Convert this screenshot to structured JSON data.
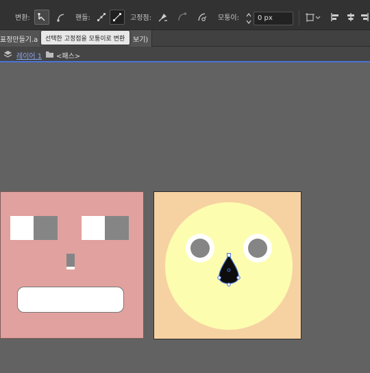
{
  "control_bar": {
    "convert_label": "변환:",
    "handle_label": "핸들:",
    "anchor_label": "고정점:",
    "corner_label": "모퉁이:",
    "corner_value": "0 px"
  },
  "tab": {
    "title_prefix": "표정만들기.a",
    "title_suffix": "보기)"
  },
  "tooltip": "선택한 고정점을 모퉁이로 변환",
  "breadcrumb": {
    "layer": "레이어 1",
    "path": "<패스>"
  },
  "colors": {
    "left_artboard": "#e1a19e",
    "right_artboard": "#f6d2a2",
    "face": "#fdfdb0",
    "eye": "#858585",
    "selection": "#4b74d8"
  },
  "icons": [
    "convert-smooth-icon",
    "convert-corner-icon",
    "handle-show-icon",
    "handle-hide-icon",
    "pen-remove-anchor-icon",
    "anchor-connect-icon",
    "anchor-cut-icon",
    "transform-icon",
    "align-left-icon",
    "align-center-icon",
    "align-right-icon",
    "layers-icon",
    "folder-icon"
  ]
}
